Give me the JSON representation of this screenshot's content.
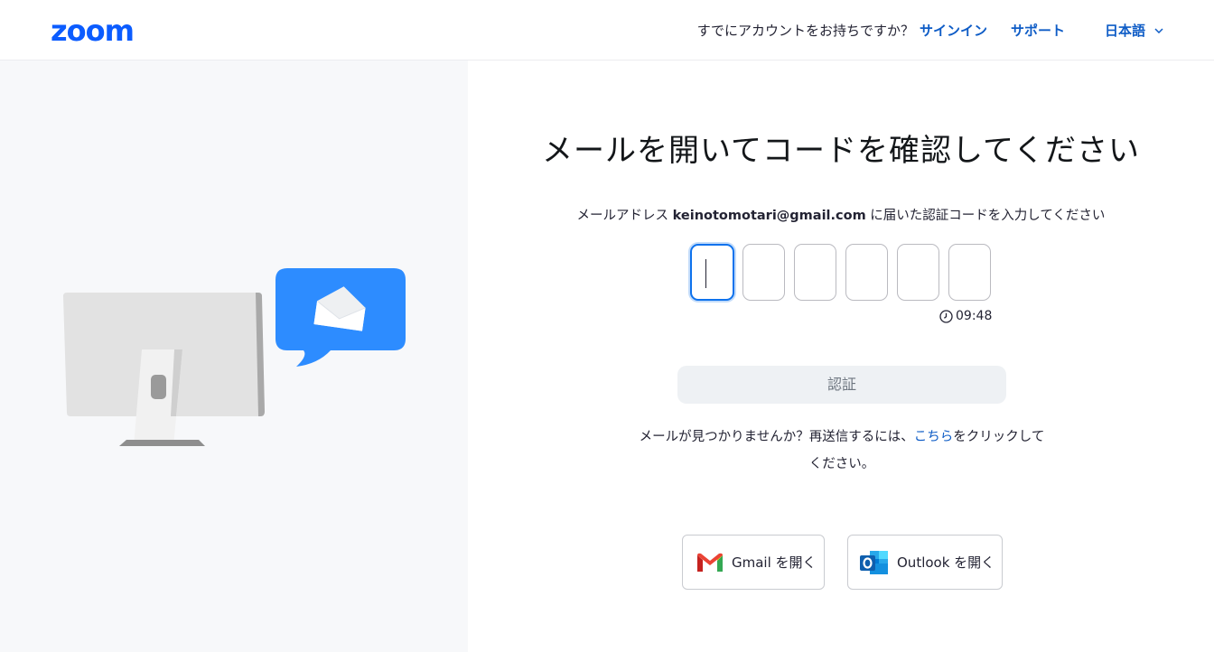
{
  "header": {
    "logo": "zoom",
    "account_question": "すでにアカウントをお持ちですか？",
    "signin_label": "サインイン",
    "support_label": "サポート",
    "language_label": "日本語"
  },
  "main": {
    "title": "メールを開いてコードを確認してください",
    "instruction_prefix": "メールアドレス ",
    "email": "keinotomotari@gmail.com",
    "instruction_suffix": " に届いた認証コードを入力してください",
    "code_digits": [
      "",
      "",
      "",
      "",
      "",
      ""
    ],
    "timer": "09:48",
    "verify_label": "認証",
    "resend_prefix": "メールが見つかりませんか？再送信するには、",
    "resend_link": "こちら",
    "resend_suffix": "をクリックしてください。",
    "gmail_label": "Gmail を開く",
    "outlook_label": "Outlook を開く"
  },
  "colors": {
    "brand": "#0b5cff",
    "link": "#0e5cc6",
    "left_panel_bg": "#f7f8fa",
    "bubble": "#2d8cff"
  }
}
